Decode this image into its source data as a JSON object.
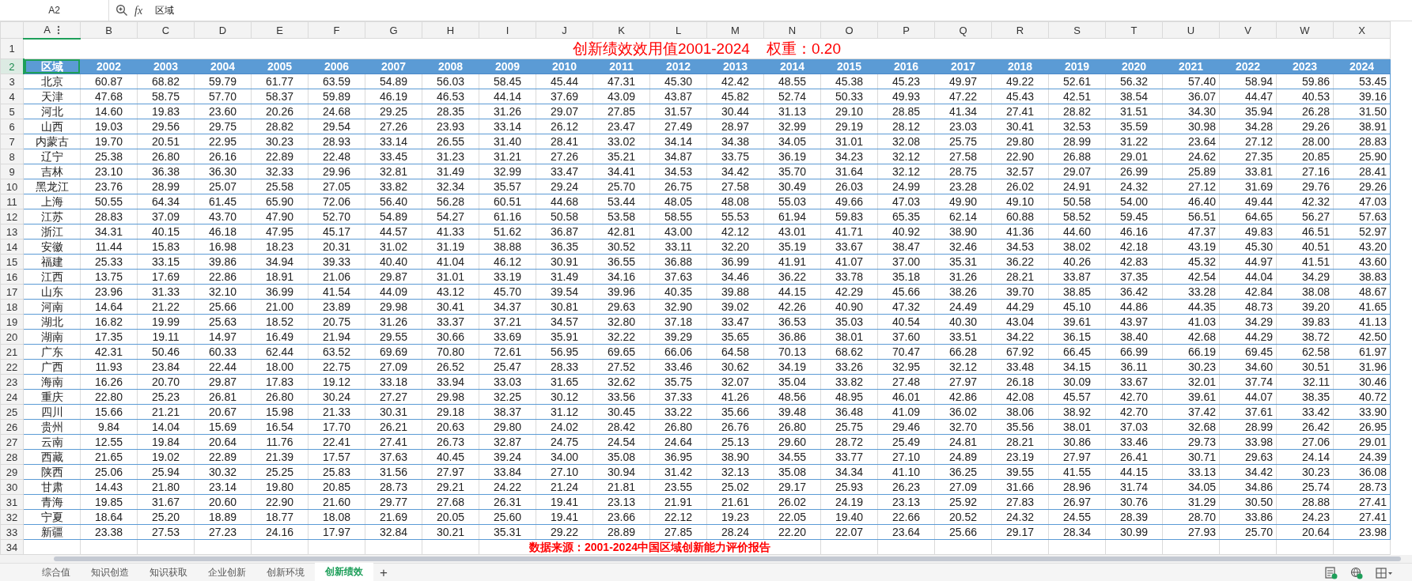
{
  "formula_bar": {
    "name_box": "A2",
    "fx_label": "fx",
    "content": "区域"
  },
  "columns": [
    {
      "label": "A",
      "selected": true
    },
    {
      "label": "B",
      "selected": false
    },
    {
      "label": "C",
      "selected": false
    },
    {
      "label": "D",
      "selected": false
    },
    {
      "label": "E",
      "selected": false
    },
    {
      "label": "F",
      "selected": false
    },
    {
      "label": "G",
      "selected": false
    },
    {
      "label": "H",
      "selected": false
    },
    {
      "label": "I",
      "selected": false
    },
    {
      "label": "J",
      "selected": false
    },
    {
      "label": "K",
      "selected": false
    },
    {
      "label": "L",
      "selected": false
    },
    {
      "label": "M",
      "selected": false
    },
    {
      "label": "N",
      "selected": false
    },
    {
      "label": "O",
      "selected": false
    },
    {
      "label": "P",
      "selected": false
    },
    {
      "label": "Q",
      "selected": false
    },
    {
      "label": "R",
      "selected": false
    },
    {
      "label": "S",
      "selected": false
    },
    {
      "label": "T",
      "selected": false
    },
    {
      "label": "U",
      "selected": false
    },
    {
      "label": "V",
      "selected": false
    },
    {
      "label": "W",
      "selected": false
    },
    {
      "label": "X",
      "selected": false
    }
  ],
  "row_headers": [
    {
      "label": "1",
      "selected": false
    },
    {
      "label": "2",
      "selected": true
    },
    {
      "label": "3",
      "selected": false
    },
    {
      "label": "4",
      "selected": false
    },
    {
      "label": "5",
      "selected": false
    },
    {
      "label": "6",
      "selected": false
    },
    {
      "label": "7",
      "selected": false
    },
    {
      "label": "8",
      "selected": false
    },
    {
      "label": "9",
      "selected": false
    },
    {
      "label": "10",
      "selected": false
    },
    {
      "label": "11",
      "selected": false
    },
    {
      "label": "12",
      "selected": false
    },
    {
      "label": "13",
      "selected": false
    },
    {
      "label": "14",
      "selected": false
    },
    {
      "label": "15",
      "selected": false
    },
    {
      "label": "16",
      "selected": false
    },
    {
      "label": "17",
      "selected": false
    },
    {
      "label": "18",
      "selected": false
    },
    {
      "label": "19",
      "selected": false
    },
    {
      "label": "20",
      "selected": false
    },
    {
      "label": "21",
      "selected": false
    },
    {
      "label": "22",
      "selected": false
    },
    {
      "label": "23",
      "selected": false
    },
    {
      "label": "24",
      "selected": false
    },
    {
      "label": "25",
      "selected": false
    },
    {
      "label": "26",
      "selected": false
    },
    {
      "label": "27",
      "selected": false
    },
    {
      "label": "28",
      "selected": false
    },
    {
      "label": "29",
      "selected": false
    },
    {
      "label": "30",
      "selected": false
    },
    {
      "label": "31",
      "selected": false
    },
    {
      "label": "32",
      "selected": false
    },
    {
      "label": "33",
      "selected": false
    },
    {
      "label": "34",
      "selected": false
    }
  ],
  "title": "创新绩效效用值2001-2024    权重：0.20",
  "header": {
    "region": "区域",
    "years": [
      "2002",
      "2003",
      "2004",
      "2005",
      "2006",
      "2007",
      "2008",
      "2009",
      "2010",
      "2011",
      "2012",
      "2013",
      "2014",
      "2015",
      "2016",
      "2017",
      "2018",
      "2019",
      "2020",
      "2021",
      "2022",
      "2023",
      "2024"
    ]
  },
  "rows": [
    {
      "region": "北京",
      "values": [
        "60.87",
        "68.82",
        "59.79",
        "61.77",
        "63.59",
        "54.89",
        "56.03",
        "58.45",
        "45.44",
        "47.31",
        "45.30",
        "42.42",
        "48.55",
        "45.38",
        "45.23",
        "49.97",
        "49.22",
        "52.61",
        "56.32",
        "57.40",
        "58.94",
        "59.86",
        "53.45"
      ]
    },
    {
      "region": "天津",
      "values": [
        "47.68",
        "58.75",
        "57.70",
        "58.37",
        "59.89",
        "46.19",
        "46.53",
        "44.14",
        "37.69",
        "43.09",
        "43.87",
        "45.82",
        "52.74",
        "50.33",
        "49.93",
        "47.22",
        "45.43",
        "42.51",
        "38.54",
        "36.07",
        "44.47",
        "40.53",
        "39.16"
      ]
    },
    {
      "region": "河北",
      "values": [
        "14.60",
        "19.83",
        "23.60",
        "20.26",
        "24.68",
        "29.25",
        "28.35",
        "31.26",
        "29.07",
        "27.85",
        "31.57",
        "30.44",
        "31.13",
        "29.10",
        "28.85",
        "41.34",
        "27.41",
        "28.82",
        "31.51",
        "34.30",
        "35.94",
        "26.28",
        "31.50"
      ]
    },
    {
      "region": "山西",
      "values": [
        "19.03",
        "29.56",
        "29.75",
        "28.82",
        "29.54",
        "27.26",
        "23.93",
        "33.14",
        "26.12",
        "23.47",
        "27.49",
        "28.97",
        "32.99",
        "29.19",
        "28.12",
        "23.03",
        "30.41",
        "32.53",
        "35.59",
        "30.98",
        "34.28",
        "29.26",
        "38.91"
      ]
    },
    {
      "region": "内蒙古",
      "values": [
        "19.70",
        "20.51",
        "22.95",
        "30.23",
        "28.93",
        "33.14",
        "26.55",
        "31.40",
        "28.41",
        "33.02",
        "34.14",
        "34.38",
        "34.05",
        "31.01",
        "32.08",
        "25.75",
        "29.80",
        "28.99",
        "31.22",
        "23.64",
        "27.12",
        "28.00",
        "28.83"
      ]
    },
    {
      "region": "辽宁",
      "values": [
        "25.38",
        "26.80",
        "26.16",
        "22.89",
        "22.48",
        "33.45",
        "31.23",
        "31.21",
        "27.26",
        "35.21",
        "34.87",
        "33.75",
        "36.19",
        "34.23",
        "32.12",
        "27.58",
        "22.90",
        "26.88",
        "29.01",
        "24.62",
        "27.35",
        "20.85",
        "25.90"
      ]
    },
    {
      "region": "吉林",
      "values": [
        "23.10",
        "36.38",
        "36.30",
        "32.33",
        "29.96",
        "32.81",
        "31.49",
        "32.99",
        "33.47",
        "34.41",
        "34.53",
        "34.42",
        "35.70",
        "31.64",
        "32.12",
        "28.75",
        "32.57",
        "29.07",
        "26.99",
        "25.89",
        "33.81",
        "27.16",
        "28.41"
      ]
    },
    {
      "region": "黑龙江",
      "values": [
        "23.76",
        "28.99",
        "25.07",
        "25.58",
        "27.05",
        "33.82",
        "32.34",
        "35.57",
        "29.24",
        "25.70",
        "26.75",
        "27.58",
        "30.49",
        "26.03",
        "24.99",
        "23.28",
        "26.02",
        "24.91",
        "24.32",
        "27.12",
        "31.69",
        "29.76",
        "29.26"
      ]
    },
    {
      "region": "上海",
      "values": [
        "50.55",
        "64.34",
        "61.45",
        "65.90",
        "72.06",
        "56.40",
        "56.28",
        "60.51",
        "44.68",
        "53.44",
        "48.05",
        "48.08",
        "55.03",
        "49.66",
        "47.03",
        "49.90",
        "49.10",
        "50.58",
        "54.00",
        "46.40",
        "49.44",
        "42.32",
        "47.03"
      ]
    },
    {
      "region": "江苏",
      "values": [
        "28.83",
        "37.09",
        "43.70",
        "47.90",
        "52.70",
        "54.89",
        "54.27",
        "61.16",
        "50.58",
        "53.58",
        "58.55",
        "55.53",
        "61.94",
        "59.83",
        "65.35",
        "62.14",
        "60.88",
        "58.52",
        "59.45",
        "56.51",
        "64.65",
        "56.27",
        "57.63"
      ]
    },
    {
      "region": "浙江",
      "values": [
        "34.31",
        "40.15",
        "46.18",
        "47.95",
        "45.17",
        "44.57",
        "41.33",
        "51.62",
        "36.87",
        "42.81",
        "43.00",
        "42.12",
        "43.01",
        "41.71",
        "40.92",
        "38.90",
        "41.36",
        "44.60",
        "46.16",
        "47.37",
        "49.83",
        "46.51",
        "52.97"
      ]
    },
    {
      "region": "安徽",
      "values": [
        "11.44",
        "15.83",
        "16.98",
        "18.23",
        "20.31",
        "31.02",
        "31.19",
        "38.88",
        "36.35",
        "30.52",
        "33.11",
        "32.20",
        "35.19",
        "33.67",
        "38.47",
        "32.46",
        "34.53",
        "38.02",
        "42.18",
        "43.19",
        "45.30",
        "40.51",
        "43.20"
      ]
    },
    {
      "region": "福建",
      "values": [
        "25.33",
        "33.15",
        "39.86",
        "34.94",
        "39.33",
        "40.40",
        "41.04",
        "46.12",
        "30.91",
        "36.55",
        "36.88",
        "36.99",
        "41.91",
        "41.07",
        "37.00",
        "35.31",
        "36.22",
        "40.26",
        "42.83",
        "45.32",
        "44.97",
        "41.51",
        "43.60"
      ]
    },
    {
      "region": "江西",
      "values": [
        "13.75",
        "17.69",
        "22.86",
        "18.91",
        "21.06",
        "29.87",
        "31.01",
        "33.19",
        "31.49",
        "34.16",
        "37.63",
        "34.46",
        "36.22",
        "33.78",
        "35.18",
        "31.26",
        "28.21",
        "33.87",
        "37.35",
        "42.54",
        "44.04",
        "34.29",
        "38.83"
      ]
    },
    {
      "region": "山东",
      "values": [
        "23.96",
        "31.33",
        "32.10",
        "36.99",
        "41.54",
        "44.09",
        "43.12",
        "45.70",
        "39.54",
        "39.96",
        "40.35",
        "39.88",
        "44.15",
        "42.29",
        "45.66",
        "38.26",
        "39.70",
        "38.85",
        "36.42",
        "33.28",
        "42.84",
        "38.08",
        "48.67"
      ]
    },
    {
      "region": "河南",
      "values": [
        "14.64",
        "21.22",
        "25.66",
        "21.00",
        "23.89",
        "29.98",
        "30.41",
        "34.37",
        "30.81",
        "29.63",
        "32.90",
        "39.02",
        "42.26",
        "40.90",
        "47.32",
        "24.49",
        "44.29",
        "45.10",
        "44.86",
        "44.35",
        "48.73",
        "39.20",
        "41.65"
      ]
    },
    {
      "region": "湖北",
      "values": [
        "16.82",
        "19.99",
        "25.63",
        "18.52",
        "20.75",
        "31.26",
        "33.37",
        "37.21",
        "34.57",
        "32.80",
        "37.18",
        "33.47",
        "36.53",
        "35.03",
        "40.54",
        "40.30",
        "43.04",
        "39.61",
        "43.97",
        "41.03",
        "34.29",
        "39.83",
        "41.13"
      ]
    },
    {
      "region": "湖南",
      "values": [
        "17.35",
        "19.11",
        "14.97",
        "16.49",
        "21.94",
        "29.55",
        "30.66",
        "33.69",
        "35.91",
        "32.22",
        "39.29",
        "35.65",
        "36.86",
        "38.01",
        "37.60",
        "33.51",
        "34.22",
        "36.15",
        "38.40",
        "42.68",
        "44.29",
        "38.72",
        "42.50"
      ]
    },
    {
      "region": "广东",
      "values": [
        "42.31",
        "50.46",
        "60.33",
        "62.44",
        "63.52",
        "69.69",
        "70.80",
        "72.61",
        "56.95",
        "69.65",
        "66.06",
        "64.58",
        "70.13",
        "68.62",
        "70.47",
        "66.28",
        "67.92",
        "66.45",
        "66.99",
        "66.19",
        "69.45",
        "62.58",
        "61.97"
      ]
    },
    {
      "region": "广西",
      "values": [
        "11.93",
        "23.84",
        "22.44",
        "18.00",
        "22.75",
        "27.09",
        "26.52",
        "25.47",
        "28.33",
        "27.52",
        "33.46",
        "30.62",
        "34.19",
        "33.26",
        "32.95",
        "32.12",
        "33.48",
        "34.15",
        "36.11",
        "30.23",
        "34.60",
        "30.51",
        "31.96"
      ]
    },
    {
      "region": "海南",
      "values": [
        "16.26",
        "20.70",
        "29.87",
        "17.83",
        "19.12",
        "33.18",
        "33.94",
        "33.03",
        "31.65",
        "32.62",
        "35.75",
        "32.07",
        "35.04",
        "33.82",
        "27.48",
        "27.97",
        "26.18",
        "30.09",
        "33.67",
        "32.01",
        "37.74",
        "32.11",
        "30.46"
      ]
    },
    {
      "region": "重庆",
      "values": [
        "22.80",
        "25.23",
        "26.81",
        "26.80",
        "30.24",
        "27.27",
        "29.98",
        "32.25",
        "30.12",
        "33.56",
        "37.33",
        "41.26",
        "48.56",
        "48.95",
        "46.01",
        "42.86",
        "42.08",
        "45.57",
        "42.70",
        "39.61",
        "44.07",
        "38.35",
        "40.72"
      ]
    },
    {
      "region": "四川",
      "values": [
        "15.66",
        "21.21",
        "20.67",
        "15.98",
        "21.33",
        "30.31",
        "29.18",
        "38.37",
        "31.12",
        "30.45",
        "33.22",
        "35.66",
        "39.48",
        "36.48",
        "41.09",
        "36.02",
        "38.06",
        "38.92",
        "42.70",
        "37.42",
        "37.61",
        "33.42",
        "33.90"
      ]
    },
    {
      "region": "贵州",
      "values": [
        "9.84",
        "14.04",
        "15.69",
        "16.54",
        "17.70",
        "26.21",
        "20.63",
        "29.80",
        "24.02",
        "28.42",
        "26.80",
        "26.76",
        "26.80",
        "25.75",
        "29.46",
        "32.70",
        "35.56",
        "38.01",
        "37.03",
        "32.68",
        "28.99",
        "26.42",
        "26.95"
      ]
    },
    {
      "region": "云南",
      "values": [
        "12.55",
        "19.84",
        "20.64",
        "11.76",
        "22.41",
        "27.41",
        "26.73",
        "32.87",
        "24.75",
        "24.54",
        "24.64",
        "25.13",
        "29.60",
        "28.72",
        "25.49",
        "24.81",
        "28.21",
        "30.86",
        "33.46",
        "29.73",
        "33.98",
        "27.06",
        "29.01"
      ]
    },
    {
      "region": "西藏",
      "values": [
        "21.65",
        "19.02",
        "22.89",
        "21.39",
        "17.57",
        "37.63",
        "40.45",
        "39.24",
        "34.00",
        "35.08",
        "36.95",
        "38.90",
        "34.55",
        "33.77",
        "27.10",
        "24.89",
        "23.19",
        "27.97",
        "26.41",
        "30.71",
        "29.63",
        "24.14",
        "24.39"
      ]
    },
    {
      "region": "陕西",
      "values": [
        "25.06",
        "25.94",
        "30.32",
        "25.25",
        "25.83",
        "31.56",
        "27.97",
        "33.84",
        "27.10",
        "30.94",
        "31.42",
        "32.13",
        "35.08",
        "34.34",
        "41.10",
        "36.25",
        "39.55",
        "41.55",
        "44.15",
        "33.13",
        "34.42",
        "30.23",
        "36.08"
      ]
    },
    {
      "region": "甘肃",
      "values": [
        "14.43",
        "21.80",
        "23.14",
        "19.80",
        "20.85",
        "28.73",
        "29.21",
        "24.22",
        "21.24",
        "21.81",
        "23.55",
        "25.02",
        "29.17",
        "25.93",
        "26.23",
        "27.09",
        "31.66",
        "28.96",
        "31.74",
        "34.05",
        "34.86",
        "25.74",
        "28.73"
      ]
    },
    {
      "region": "青海",
      "values": [
        "19.85",
        "31.67",
        "20.60",
        "22.90",
        "21.60",
        "29.77",
        "27.68",
        "26.31",
        "19.41",
        "23.13",
        "21.91",
        "21.61",
        "26.02",
        "24.19",
        "23.13",
        "25.92",
        "27.83",
        "26.97",
        "30.76",
        "31.29",
        "30.50",
        "28.88",
        "27.41"
      ]
    },
    {
      "region": "宁夏",
      "values": [
        "18.64",
        "25.20",
        "18.89",
        "18.77",
        "18.08",
        "21.69",
        "20.05",
        "25.60",
        "19.41",
        "23.66",
        "22.12",
        "19.23",
        "22.05",
        "19.40",
        "22.66",
        "20.52",
        "24.32",
        "24.55",
        "28.39",
        "28.70",
        "33.86",
        "24.23",
        "27.41"
      ]
    },
    {
      "region": "新疆",
      "values": [
        "23.38",
        "27.53",
        "27.23",
        "24.16",
        "17.97",
        "32.84",
        "30.21",
        "35.31",
        "29.22",
        "28.89",
        "27.85",
        "28.24",
        "22.20",
        "22.07",
        "23.64",
        "25.66",
        "29.17",
        "28.34",
        "30.99",
        "27.93",
        "25.70",
        "20.64",
        "23.98"
      ]
    }
  ],
  "footnote": "数据来源：2001-2024中国区域创新能力评价报告",
  "sheet_tabs": [
    {
      "label": "综合值",
      "selected": false
    },
    {
      "label": "知识创造",
      "selected": false
    },
    {
      "label": "知识获取",
      "selected": false
    },
    {
      "label": "企业创新",
      "selected": false
    },
    {
      "label": "创新环境",
      "selected": false
    },
    {
      "label": "创新绩效",
      "selected": true
    }
  ],
  "add_sheet": "+"
}
